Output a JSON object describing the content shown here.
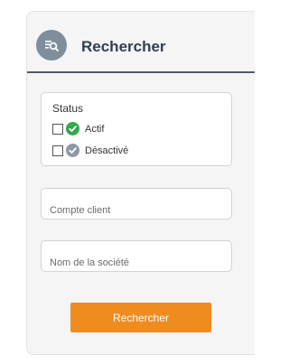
{
  "header": {
    "title": "Rechercher",
    "icon": "search-list-icon"
  },
  "status": {
    "label": "Status",
    "options": [
      {
        "label": "Actif",
        "icon": "check-circle-icon",
        "color": "#33a84d",
        "checked": false
      },
      {
        "label": "Désactivé",
        "icon": "check-circle-icon",
        "color": "#8f99a6",
        "checked": false
      }
    ]
  },
  "fields": {
    "compte_client": {
      "placeholder": "Compte client",
      "value": ""
    },
    "nom_societe": {
      "placeholder": "Nom de la société",
      "value": ""
    }
  },
  "actions": {
    "search_label": "Rechercher"
  },
  "colors": {
    "accent": "#f08b1f",
    "header_text": "#2f3f52",
    "divider": "#4c5a6b",
    "active_green": "#33a84d",
    "inactive_grey": "#8f99a6"
  }
}
